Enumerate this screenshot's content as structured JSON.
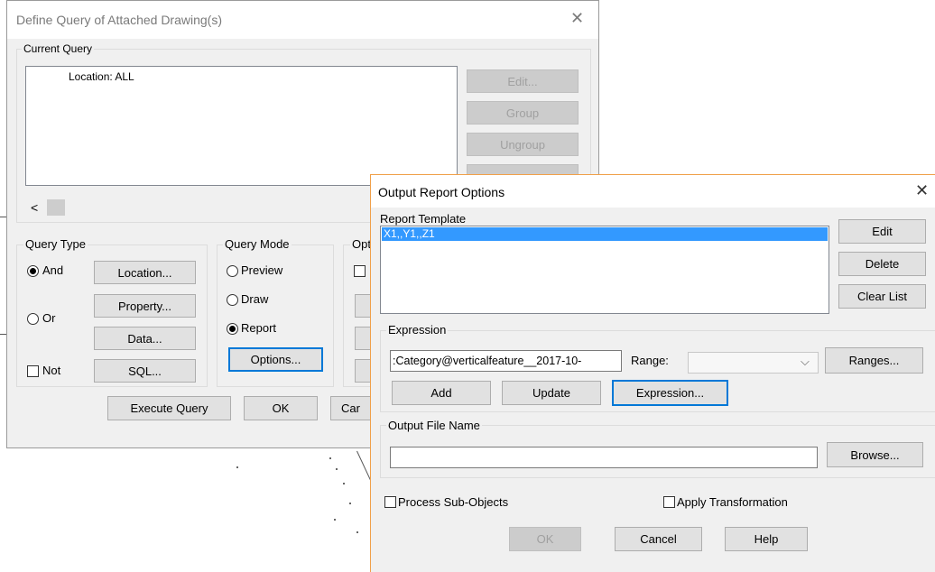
{
  "query_dialog": {
    "title": "Define Query of Attached Drawing(s)",
    "current_query": {
      "group_label": "Current Query",
      "text": "Location: ALL"
    },
    "side_buttons": {
      "edit": "Edit...",
      "group": "Group",
      "ungroup": "Ungroup"
    },
    "scroll_left_glyph": "<",
    "query_type": {
      "label": "Query Type",
      "and": "And",
      "or": "Or",
      "not": "Not",
      "location": "Location...",
      "property": "Property...",
      "data": "Data...",
      "sql": "SQL..."
    },
    "query_mode": {
      "label": "Query Mode",
      "preview": "Preview",
      "draw": "Draw",
      "report": "Report",
      "options": "Options..."
    },
    "options_label_partial": "Opt",
    "bottom": {
      "execute": "Execute Query",
      "ok": "OK",
      "cancel_partial": "Car"
    }
  },
  "report_dialog": {
    "title": "Output Report Options",
    "template": {
      "label": "Report Template",
      "items": [
        "X1,,Y1,,Z1"
      ],
      "edit": "Edit",
      "delete": "Delete",
      "clear": "Clear List"
    },
    "expression": {
      "label": "Expression",
      "value": ":Category@verticalfeature__2017-10-",
      "range_label": "Range:",
      "range_value": "",
      "ranges": "Ranges...",
      "add": "Add",
      "update": "Update",
      "expression_btn": "Expression..."
    },
    "output": {
      "label": "Output File Name",
      "value": "",
      "browse": "Browse..."
    },
    "process_sub": "Process Sub-Objects",
    "apply_transform": "Apply Transformation",
    "ok": "OK",
    "cancel": "Cancel",
    "help": "Help"
  },
  "colors": {
    "accent": "#0078d7",
    "selection": "#3399ff",
    "dialog_bg": "#f0f0f0"
  }
}
